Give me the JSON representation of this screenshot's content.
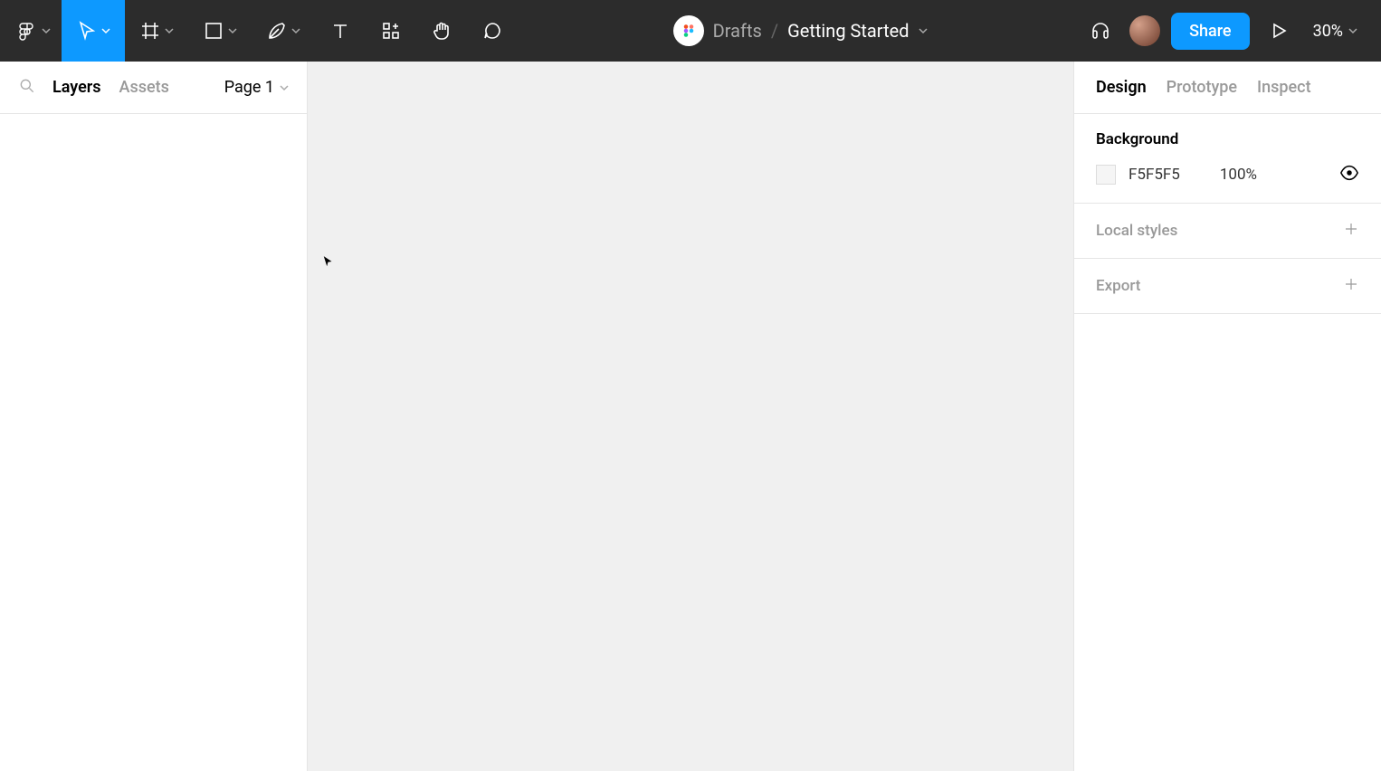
{
  "breadcrumb": {
    "drafts": "Drafts",
    "sep": "/",
    "title": "Getting Started"
  },
  "toolbar": {
    "share_label": "Share",
    "zoom": "30%"
  },
  "leftPanel": {
    "tabs": {
      "layers": "Layers",
      "assets": "Assets"
    },
    "pageSelector": "Page 1"
  },
  "rightPanel": {
    "tabs": {
      "design": "Design",
      "prototype": "Prototype",
      "inspect": "Inspect"
    },
    "background": {
      "title": "Background",
      "hex": "F5F5F5",
      "opacity": "100%"
    },
    "localStyles": "Local styles",
    "export": "Export"
  }
}
